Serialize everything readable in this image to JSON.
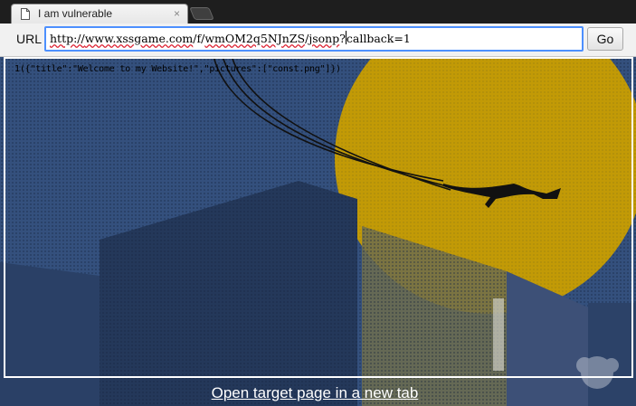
{
  "browser": {
    "tab": {
      "title": "I am vulnerable",
      "file_icon": "file-icon",
      "close_glyph": "×"
    },
    "toolbar": {
      "url_label": "URL",
      "url": {
        "scheme": "http://",
        "host": "www.xssgame.com",
        "sep1": "/f/",
        "path_id": "wmOM2q5NJnZS",
        "sep2": "/",
        "endpoint": "jsonp",
        "query_before_caret": "?",
        "query_after_caret": "callback=1"
      },
      "go_label": "Go"
    }
  },
  "page": {
    "response_text": "1({\"title\":\"Welcome to my Website!\",\"pictures\":[\"const.png\"]})",
    "open_link_label": "Open target page in a new tab"
  },
  "colors": {
    "sky": "#2f4a73",
    "moon": "#c49a05",
    "buildings": "#24385a",
    "accent_focus": "#4d90fe"
  }
}
